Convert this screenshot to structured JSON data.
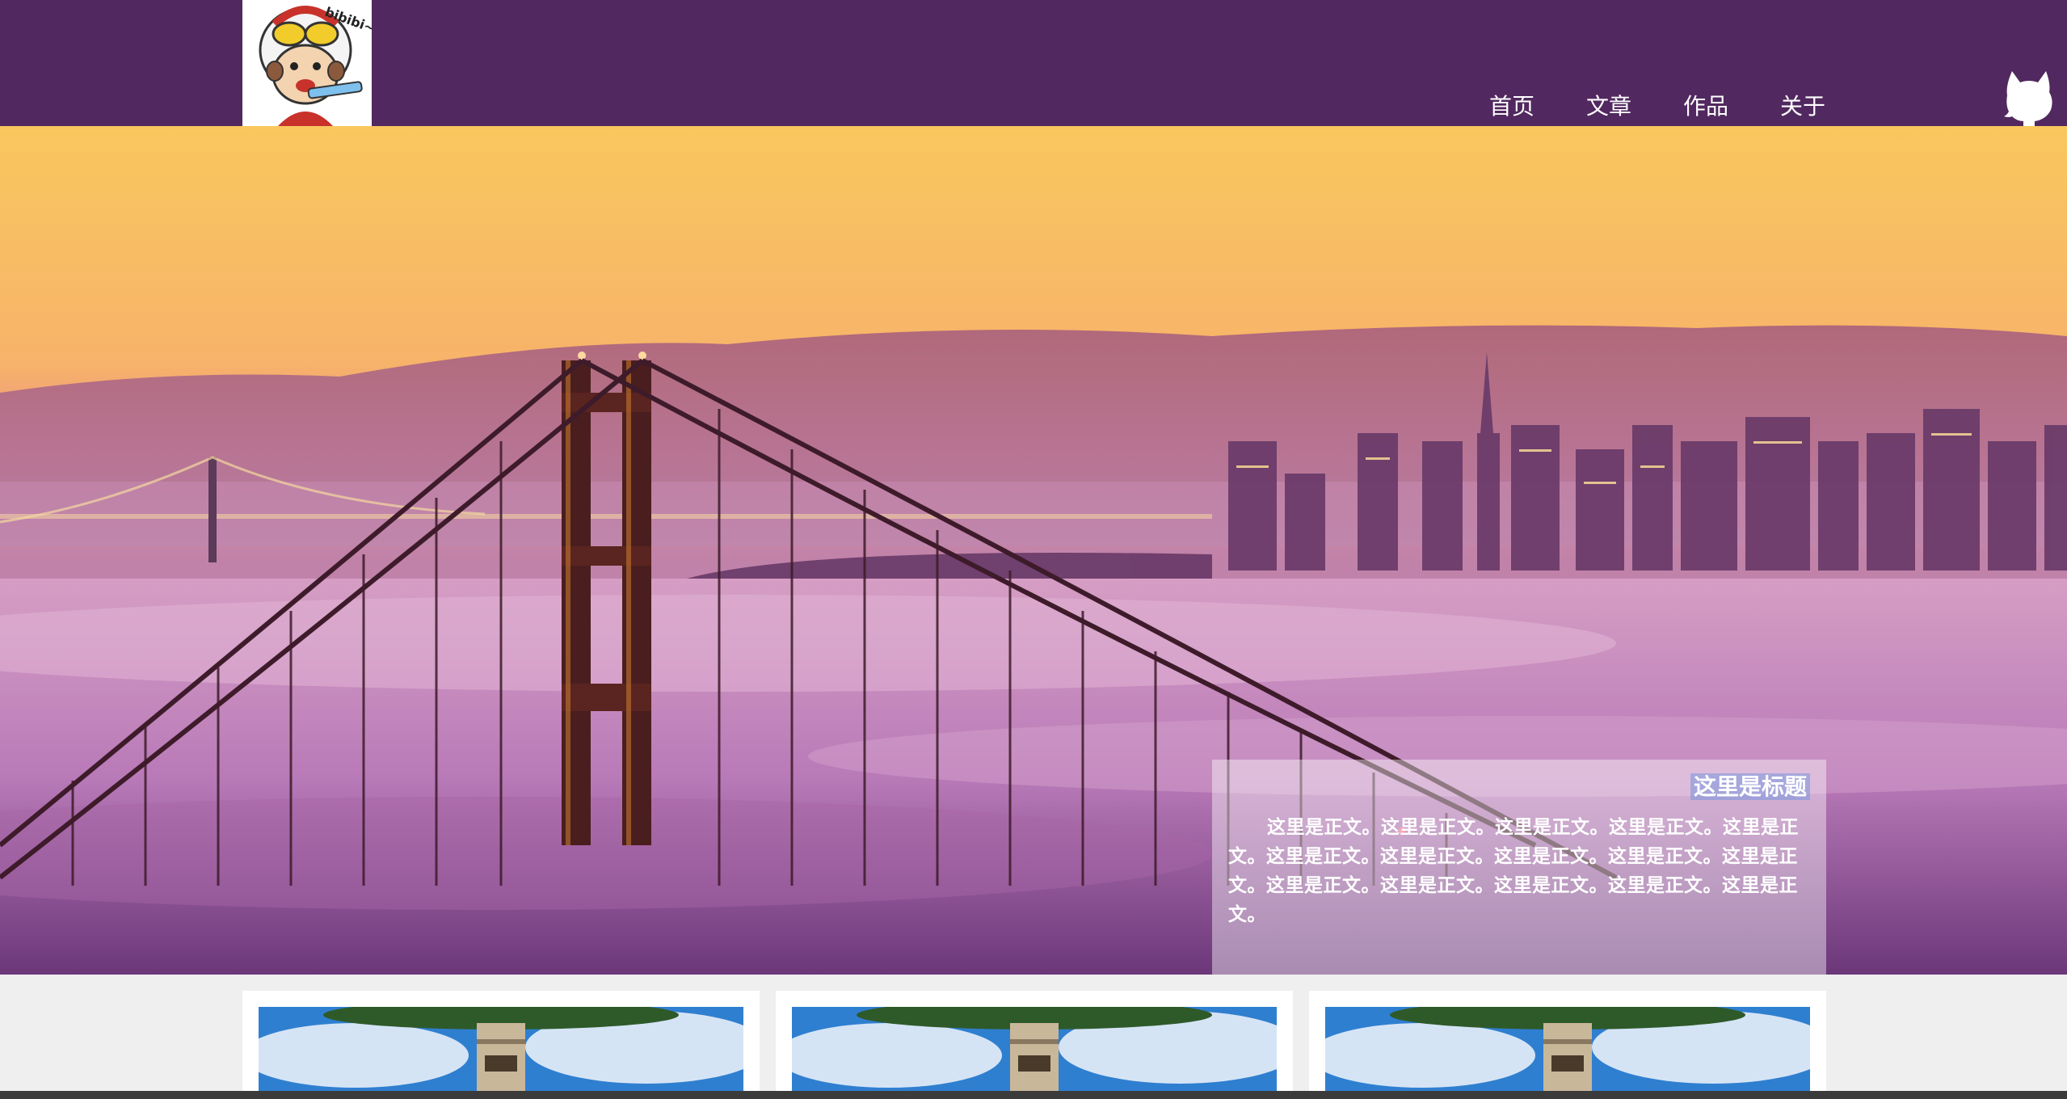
{
  "header": {
    "logo_text": "bibibi~",
    "nav": [
      {
        "label": "首页"
      },
      {
        "label": "文章"
      },
      {
        "label": "作品"
      },
      {
        "label": "关于"
      }
    ],
    "github_icon": "github-octocat-icon"
  },
  "hero": {
    "image": "golden-gate-bridge-fog-sunset",
    "caption": {
      "title": "这里是标题",
      "body": "这里是正文。这里是正文。这里是正文。这里是正文。这里是正文。这里是正文。这里是正文。这里是正文。这里是正文。这里是正文。这里是正文。这里是正文。这里是正文。这里是正文。这里是正文。"
    }
  },
  "cards": [
    {
      "image": "building-blue-sky-thumbnail"
    },
    {
      "image": "building-blue-sky-thumbnail"
    },
    {
      "image": "building-blue-sky-thumbnail"
    }
  ],
  "colors": {
    "header_bg": "#51285f",
    "page_bg": "#efefef",
    "nav_text": "#ffffff"
  }
}
